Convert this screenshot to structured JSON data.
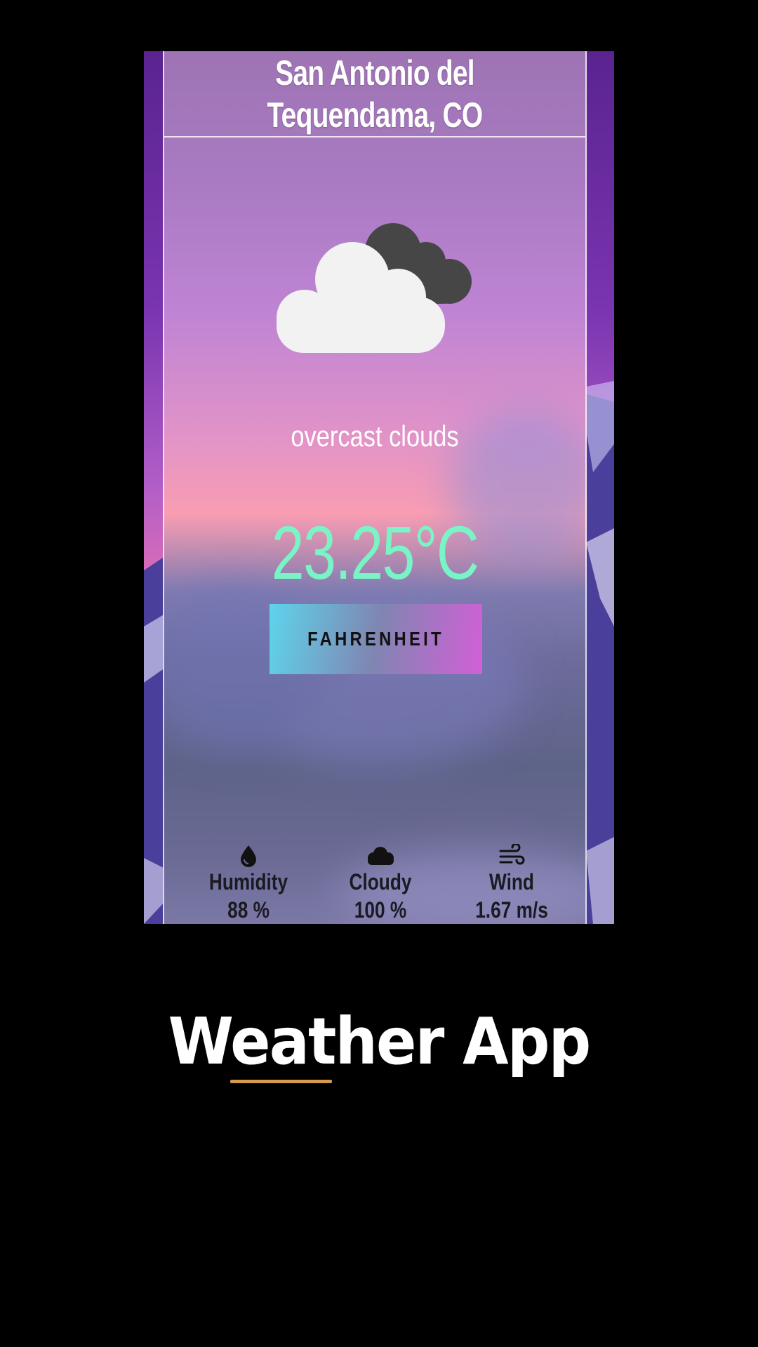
{
  "weather": {
    "location": "San Antonio del Tequendama, CO",
    "description": "overcast clouds",
    "temperature": "23.25°C",
    "toggle_unit_label": "FAHRENHEIT",
    "condition_icon": "cloud-overcast-icon"
  },
  "stats": [
    {
      "icon": "droplet-icon",
      "label": "Humidity",
      "value": "88 %"
    },
    {
      "icon": "cloud-icon",
      "label": "Cloudy",
      "value": "100 %"
    },
    {
      "icon": "wind-icon",
      "label": "Wind",
      "value": "1.67 m/s"
    }
  ],
  "page": {
    "title": "Weather App"
  },
  "colors": {
    "background": "#000000",
    "temperature": "#7af3c6",
    "accent_underline": "#d69a4c",
    "button_gradient_start": "#5ed4ec",
    "button_gradient_end": "#d35fd6"
  }
}
